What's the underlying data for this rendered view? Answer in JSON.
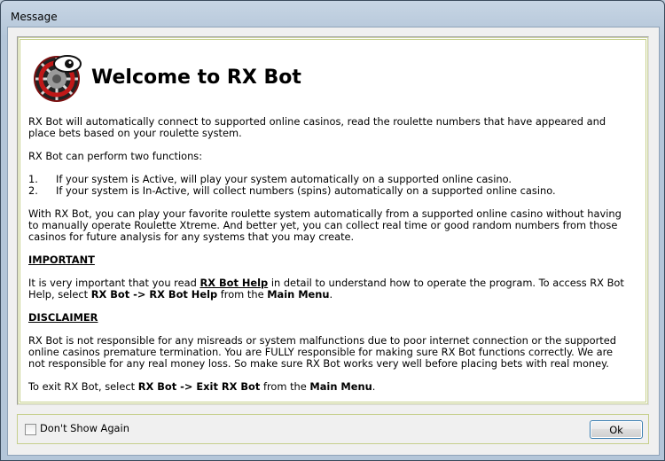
{
  "window": {
    "title": "Message"
  },
  "heading": "Welcome to RX Bot",
  "body": {
    "intro": "RX Bot will automatically connect to supported online casinos, read the roulette numbers that have appeared and place bets based on your roulette system.",
    "functions_intro": "RX Bot can perform two functions:",
    "functions": [
      {
        "num": "1.",
        "text": "If your system is Active, will play your system automatically on a supported online casino."
      },
      {
        "num": "2.",
        "text": "If your system is In-Active, will collect numbers (spins) automatically on a supported online casino."
      }
    ],
    "description": "With RX Bot, you can play your favorite roulette system automatically from a supported online casino without having to manually operate Roulette Xtreme.  And better yet, you can collect real time or good random numbers from those casinos for future analysis for any systems that you may create.",
    "important": {
      "title": "IMPORTANT",
      "p1": "It is very important that you read ",
      "help_link": "RX Bot Help",
      "p2": " in detail to understand how to operate the program.  To access RX Bot Help, select ",
      "menu_rx": "RX Bot",
      "arrow": " -> ",
      "menu_help": "RX Bot Help",
      "p3": " from the ",
      "main_menu": "Main Menu",
      "p4": "."
    },
    "disclaimer": {
      "title": "DISCLAIMER",
      "text": "RX Bot is not responsible for any misreads or system malfunctions due to poor internet connection or the supported online casinos premature termination.  You are FULLY responsible for making sure RX Bot functions correctly.  We are not responsible for any real money loss.  So make sure RX Bot works very well before placing bets with real money."
    },
    "exit": {
      "p1": "To exit RX Bot, select ",
      "menu_rx": "RX Bot",
      "arrow": "  -> ",
      "menu_exit": "Exit RX Bot",
      "p2": " from the ",
      "main_menu": "Main Menu",
      "p3": "."
    }
  },
  "footer": {
    "dont_show_label": "Don't Show Again",
    "dont_show_checked": false,
    "ok_label": "Ok"
  },
  "logo": {
    "icon": "roulette-wheel-eye-icon"
  }
}
